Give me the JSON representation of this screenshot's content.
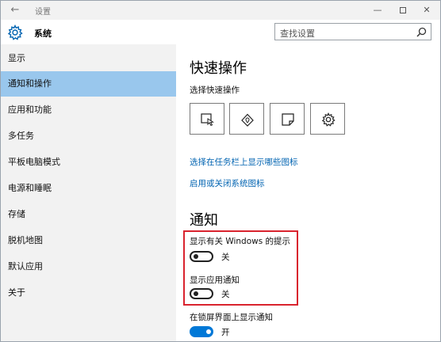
{
  "titlebar": {
    "title": "设置",
    "back_icon": "←",
    "minimize_icon": "—",
    "close_icon": "✕"
  },
  "header": {
    "section_title": "系统",
    "search_placeholder": "查找设置"
  },
  "sidebar": {
    "items": [
      {
        "label": "显示"
      },
      {
        "label": "通知和操作"
      },
      {
        "label": "应用和功能"
      },
      {
        "label": "多任务"
      },
      {
        "label": "平板电脑模式"
      },
      {
        "label": "电源和睡眠"
      },
      {
        "label": "存储"
      },
      {
        "label": "脱机地图"
      },
      {
        "label": "默认应用"
      },
      {
        "label": "关于"
      }
    ],
    "active_index": 1
  },
  "main": {
    "quick_actions": {
      "heading": "快速操作",
      "subheading": "选择快速操作",
      "buttons": [
        {
          "icon": "tablet-mode-icon"
        },
        {
          "icon": "location-icon"
        },
        {
          "icon": "note-icon"
        },
        {
          "icon": "settings-gear-icon"
        }
      ]
    },
    "links": {
      "taskbar_icons": "选择在任务栏上显示哪些图标",
      "system_icons": "启用或关闭系统图标"
    },
    "notifications": {
      "heading": "通知",
      "windows_tips": {
        "label": "显示有关 Windows 的提示",
        "state": "关",
        "on": false
      },
      "app_notifications": {
        "label": "显示应用通知",
        "state": "关",
        "on": false
      },
      "lock_screen": {
        "label": "在锁屏界面上显示通知",
        "state": "开",
        "on": true
      }
    }
  },
  "colors": {
    "accent": "#0078d7",
    "link": "#0063b1",
    "sidebar_active": "#99c7ed",
    "highlight_box": "#d9232e"
  }
}
